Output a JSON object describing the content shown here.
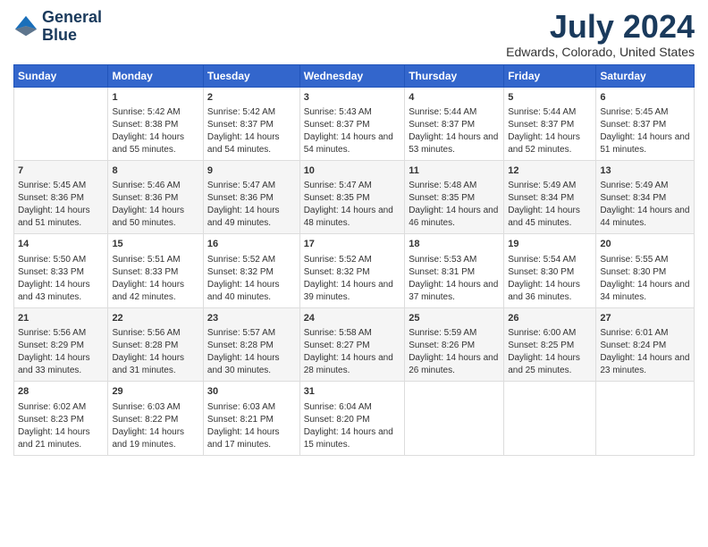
{
  "logo": {
    "line1": "General",
    "line2": "Blue"
  },
  "title": "July 2024",
  "subtitle": "Edwards, Colorado, United States",
  "headers": [
    "Sunday",
    "Monday",
    "Tuesday",
    "Wednesday",
    "Thursday",
    "Friday",
    "Saturday"
  ],
  "weeks": [
    [
      {
        "day": "",
        "sunrise": "",
        "sunset": "",
        "daylight": ""
      },
      {
        "day": "1",
        "sunrise": "Sunrise: 5:42 AM",
        "sunset": "Sunset: 8:38 PM",
        "daylight": "Daylight: 14 hours and 55 minutes."
      },
      {
        "day": "2",
        "sunrise": "Sunrise: 5:42 AM",
        "sunset": "Sunset: 8:37 PM",
        "daylight": "Daylight: 14 hours and 54 minutes."
      },
      {
        "day": "3",
        "sunrise": "Sunrise: 5:43 AM",
        "sunset": "Sunset: 8:37 PM",
        "daylight": "Daylight: 14 hours and 54 minutes."
      },
      {
        "day": "4",
        "sunrise": "Sunrise: 5:44 AM",
        "sunset": "Sunset: 8:37 PM",
        "daylight": "Daylight: 14 hours and 53 minutes."
      },
      {
        "day": "5",
        "sunrise": "Sunrise: 5:44 AM",
        "sunset": "Sunset: 8:37 PM",
        "daylight": "Daylight: 14 hours and 52 minutes."
      },
      {
        "day": "6",
        "sunrise": "Sunrise: 5:45 AM",
        "sunset": "Sunset: 8:37 PM",
        "daylight": "Daylight: 14 hours and 51 minutes."
      }
    ],
    [
      {
        "day": "7",
        "sunrise": "Sunrise: 5:45 AM",
        "sunset": "Sunset: 8:36 PM",
        "daylight": "Daylight: 14 hours and 51 minutes."
      },
      {
        "day": "8",
        "sunrise": "Sunrise: 5:46 AM",
        "sunset": "Sunset: 8:36 PM",
        "daylight": "Daylight: 14 hours and 50 minutes."
      },
      {
        "day": "9",
        "sunrise": "Sunrise: 5:47 AM",
        "sunset": "Sunset: 8:36 PM",
        "daylight": "Daylight: 14 hours and 49 minutes."
      },
      {
        "day": "10",
        "sunrise": "Sunrise: 5:47 AM",
        "sunset": "Sunset: 8:35 PM",
        "daylight": "Daylight: 14 hours and 48 minutes."
      },
      {
        "day": "11",
        "sunrise": "Sunrise: 5:48 AM",
        "sunset": "Sunset: 8:35 PM",
        "daylight": "Daylight: 14 hours and 46 minutes."
      },
      {
        "day": "12",
        "sunrise": "Sunrise: 5:49 AM",
        "sunset": "Sunset: 8:34 PM",
        "daylight": "Daylight: 14 hours and 45 minutes."
      },
      {
        "day": "13",
        "sunrise": "Sunrise: 5:49 AM",
        "sunset": "Sunset: 8:34 PM",
        "daylight": "Daylight: 14 hours and 44 minutes."
      }
    ],
    [
      {
        "day": "14",
        "sunrise": "Sunrise: 5:50 AM",
        "sunset": "Sunset: 8:33 PM",
        "daylight": "Daylight: 14 hours and 43 minutes."
      },
      {
        "day": "15",
        "sunrise": "Sunrise: 5:51 AM",
        "sunset": "Sunset: 8:33 PM",
        "daylight": "Daylight: 14 hours and 42 minutes."
      },
      {
        "day": "16",
        "sunrise": "Sunrise: 5:52 AM",
        "sunset": "Sunset: 8:32 PM",
        "daylight": "Daylight: 14 hours and 40 minutes."
      },
      {
        "day": "17",
        "sunrise": "Sunrise: 5:52 AM",
        "sunset": "Sunset: 8:32 PM",
        "daylight": "Daylight: 14 hours and 39 minutes."
      },
      {
        "day": "18",
        "sunrise": "Sunrise: 5:53 AM",
        "sunset": "Sunset: 8:31 PM",
        "daylight": "Daylight: 14 hours and 37 minutes."
      },
      {
        "day": "19",
        "sunrise": "Sunrise: 5:54 AM",
        "sunset": "Sunset: 8:30 PM",
        "daylight": "Daylight: 14 hours and 36 minutes."
      },
      {
        "day": "20",
        "sunrise": "Sunrise: 5:55 AM",
        "sunset": "Sunset: 8:30 PM",
        "daylight": "Daylight: 14 hours and 34 minutes."
      }
    ],
    [
      {
        "day": "21",
        "sunrise": "Sunrise: 5:56 AM",
        "sunset": "Sunset: 8:29 PM",
        "daylight": "Daylight: 14 hours and 33 minutes."
      },
      {
        "day": "22",
        "sunrise": "Sunrise: 5:56 AM",
        "sunset": "Sunset: 8:28 PM",
        "daylight": "Daylight: 14 hours and 31 minutes."
      },
      {
        "day": "23",
        "sunrise": "Sunrise: 5:57 AM",
        "sunset": "Sunset: 8:28 PM",
        "daylight": "Daylight: 14 hours and 30 minutes."
      },
      {
        "day": "24",
        "sunrise": "Sunrise: 5:58 AM",
        "sunset": "Sunset: 8:27 PM",
        "daylight": "Daylight: 14 hours and 28 minutes."
      },
      {
        "day": "25",
        "sunrise": "Sunrise: 5:59 AM",
        "sunset": "Sunset: 8:26 PM",
        "daylight": "Daylight: 14 hours and 26 minutes."
      },
      {
        "day": "26",
        "sunrise": "Sunrise: 6:00 AM",
        "sunset": "Sunset: 8:25 PM",
        "daylight": "Daylight: 14 hours and 25 minutes."
      },
      {
        "day": "27",
        "sunrise": "Sunrise: 6:01 AM",
        "sunset": "Sunset: 8:24 PM",
        "daylight": "Daylight: 14 hours and 23 minutes."
      }
    ],
    [
      {
        "day": "28",
        "sunrise": "Sunrise: 6:02 AM",
        "sunset": "Sunset: 8:23 PM",
        "daylight": "Daylight: 14 hours and 21 minutes."
      },
      {
        "day": "29",
        "sunrise": "Sunrise: 6:03 AM",
        "sunset": "Sunset: 8:22 PM",
        "daylight": "Daylight: 14 hours and 19 minutes."
      },
      {
        "day": "30",
        "sunrise": "Sunrise: 6:03 AM",
        "sunset": "Sunset: 8:21 PM",
        "daylight": "Daylight: 14 hours and 17 minutes."
      },
      {
        "day": "31",
        "sunrise": "Sunrise: 6:04 AM",
        "sunset": "Sunset: 8:20 PM",
        "daylight": "Daylight: 14 hours and 15 minutes."
      },
      {
        "day": "",
        "sunrise": "",
        "sunset": "",
        "daylight": ""
      },
      {
        "day": "",
        "sunrise": "",
        "sunset": "",
        "daylight": ""
      },
      {
        "day": "",
        "sunrise": "",
        "sunset": "",
        "daylight": ""
      }
    ]
  ]
}
